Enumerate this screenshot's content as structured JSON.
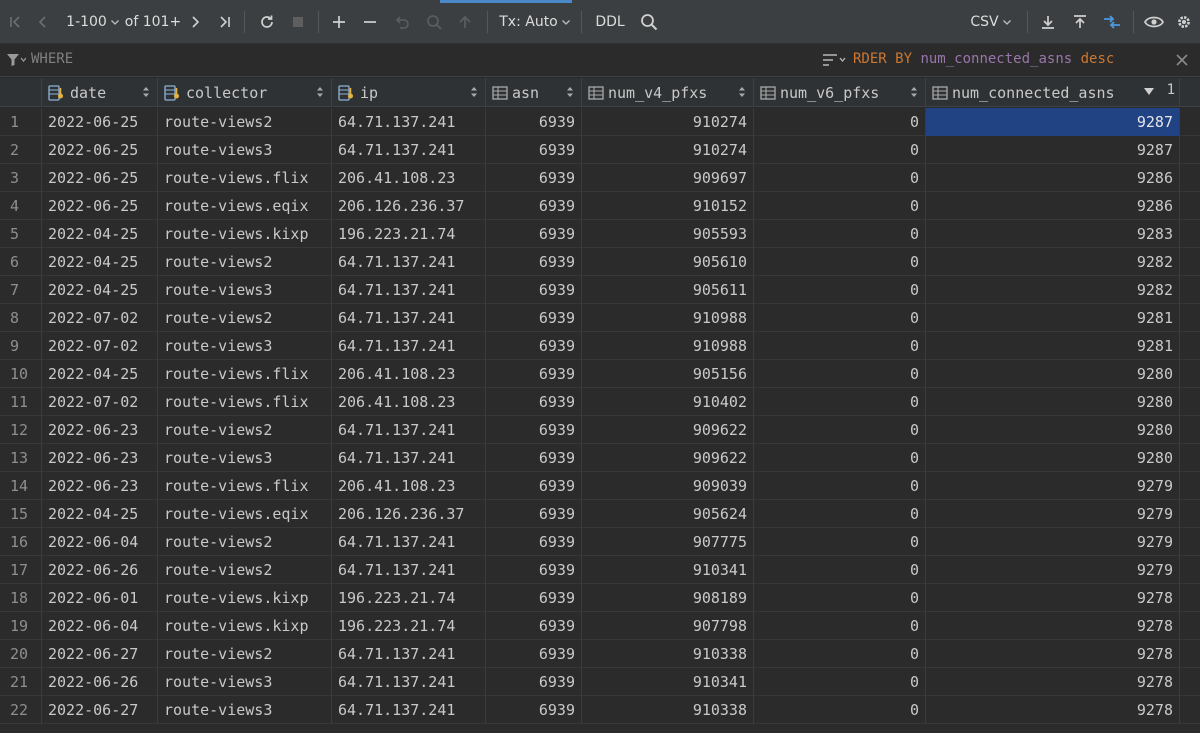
{
  "toolbar": {
    "page_range": "1-100",
    "of_total": "of 101+",
    "tx_mode": "Tx: Auto",
    "ddl_label": "DDL",
    "export_format": "CSV"
  },
  "filter": {
    "where_label": "WHERE",
    "order_by_keyword": "RDER BY",
    "order_by_column": "num_connected_asns",
    "order_by_dir": "desc"
  },
  "columns": [
    {
      "label": "date",
      "type": "key"
    },
    {
      "label": "collector",
      "type": "key"
    },
    {
      "label": "ip",
      "type": "key"
    },
    {
      "label": "asn",
      "type": "col"
    },
    {
      "label": "num_v4_pfxs",
      "type": "col"
    },
    {
      "label": "num_v6_pfxs",
      "type": "col"
    },
    {
      "label": "num_connected_asns",
      "type": "col",
      "sort_rank": "1"
    }
  ],
  "rows": [
    {
      "n": "1",
      "date": "2022-06-25",
      "collector": "route-views2",
      "ip": "64.71.137.241",
      "asn": "6939",
      "v4": "910274",
      "v6": "0",
      "conn": "9287"
    },
    {
      "n": "2",
      "date": "2022-06-25",
      "collector": "route-views3",
      "ip": "64.71.137.241",
      "asn": "6939",
      "v4": "910274",
      "v6": "0",
      "conn": "9287"
    },
    {
      "n": "3",
      "date": "2022-06-25",
      "collector": "route-views.flix",
      "ip": "206.41.108.23",
      "asn": "6939",
      "v4": "909697",
      "v6": "0",
      "conn": "9286"
    },
    {
      "n": "4",
      "date": "2022-06-25",
      "collector": "route-views.eqix",
      "ip": "206.126.236.37",
      "asn": "6939",
      "v4": "910152",
      "v6": "0",
      "conn": "9286"
    },
    {
      "n": "5",
      "date": "2022-04-25",
      "collector": "route-views.kixp",
      "ip": "196.223.21.74",
      "asn": "6939",
      "v4": "905593",
      "v6": "0",
      "conn": "9283"
    },
    {
      "n": "6",
      "date": "2022-04-25",
      "collector": "route-views2",
      "ip": "64.71.137.241",
      "asn": "6939",
      "v4": "905610",
      "v6": "0",
      "conn": "9282"
    },
    {
      "n": "7",
      "date": "2022-04-25",
      "collector": "route-views3",
      "ip": "64.71.137.241",
      "asn": "6939",
      "v4": "905611",
      "v6": "0",
      "conn": "9282"
    },
    {
      "n": "8",
      "date": "2022-07-02",
      "collector": "route-views2",
      "ip": "64.71.137.241",
      "asn": "6939",
      "v4": "910988",
      "v6": "0",
      "conn": "9281"
    },
    {
      "n": "9",
      "date": "2022-07-02",
      "collector": "route-views3",
      "ip": "64.71.137.241",
      "asn": "6939",
      "v4": "910988",
      "v6": "0",
      "conn": "9281"
    },
    {
      "n": "10",
      "date": "2022-04-25",
      "collector": "route-views.flix",
      "ip": "206.41.108.23",
      "asn": "6939",
      "v4": "905156",
      "v6": "0",
      "conn": "9280"
    },
    {
      "n": "11",
      "date": "2022-07-02",
      "collector": "route-views.flix",
      "ip": "206.41.108.23",
      "asn": "6939",
      "v4": "910402",
      "v6": "0",
      "conn": "9280"
    },
    {
      "n": "12",
      "date": "2022-06-23",
      "collector": "route-views2",
      "ip": "64.71.137.241",
      "asn": "6939",
      "v4": "909622",
      "v6": "0",
      "conn": "9280"
    },
    {
      "n": "13",
      "date": "2022-06-23",
      "collector": "route-views3",
      "ip": "64.71.137.241",
      "asn": "6939",
      "v4": "909622",
      "v6": "0",
      "conn": "9280"
    },
    {
      "n": "14",
      "date": "2022-06-23",
      "collector": "route-views.flix",
      "ip": "206.41.108.23",
      "asn": "6939",
      "v4": "909039",
      "v6": "0",
      "conn": "9279"
    },
    {
      "n": "15",
      "date": "2022-04-25",
      "collector": "route-views.eqix",
      "ip": "206.126.236.37",
      "asn": "6939",
      "v4": "905624",
      "v6": "0",
      "conn": "9279"
    },
    {
      "n": "16",
      "date": "2022-06-04",
      "collector": "route-views2",
      "ip": "64.71.137.241",
      "asn": "6939",
      "v4": "907775",
      "v6": "0",
      "conn": "9279"
    },
    {
      "n": "17",
      "date": "2022-06-26",
      "collector": "route-views2",
      "ip": "64.71.137.241",
      "asn": "6939",
      "v4": "910341",
      "v6": "0",
      "conn": "9279"
    },
    {
      "n": "18",
      "date": "2022-06-01",
      "collector": "route-views.kixp",
      "ip": "196.223.21.74",
      "asn": "6939",
      "v4": "908189",
      "v6": "0",
      "conn": "9278"
    },
    {
      "n": "19",
      "date": "2022-06-04",
      "collector": "route-views.kixp",
      "ip": "196.223.21.74",
      "asn": "6939",
      "v4": "907798",
      "v6": "0",
      "conn": "9278"
    },
    {
      "n": "20",
      "date": "2022-06-27",
      "collector": "route-views2",
      "ip": "64.71.137.241",
      "asn": "6939",
      "v4": "910338",
      "v6": "0",
      "conn": "9278"
    },
    {
      "n": "21",
      "date": "2022-06-26",
      "collector": "route-views3",
      "ip": "64.71.137.241",
      "asn": "6939",
      "v4": "910341",
      "v6": "0",
      "conn": "9278"
    },
    {
      "n": "22",
      "date": "2022-06-27",
      "collector": "route-views3",
      "ip": "64.71.137.241",
      "asn": "6939",
      "v4": "910338",
      "v6": "0",
      "conn": "9278"
    }
  ],
  "colors": {
    "selection": "#214283",
    "keyword": "#cc7832",
    "column_ref": "#9876aa",
    "accent": "#4a88c7"
  }
}
